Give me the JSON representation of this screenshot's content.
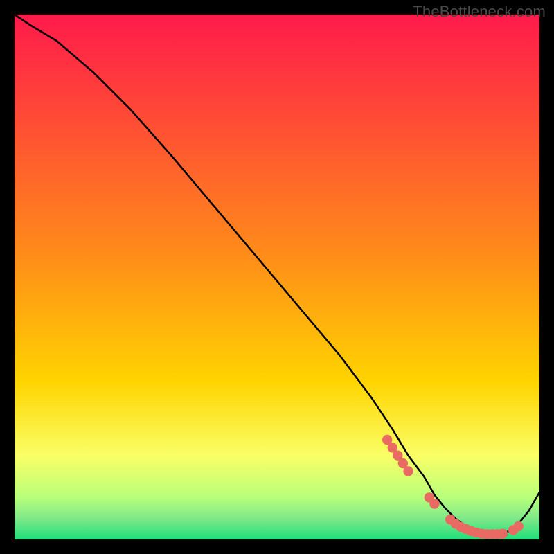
{
  "watermark": "TheBottleneck.com",
  "colors": {
    "curve": "#000000",
    "dots": "#e86a62",
    "bg_top": "#ff1a4b",
    "bg_mid": "#ffd400",
    "bg_low1": "#faff66",
    "bg_low2": "#b8ff7a",
    "bg_bottom": "#1fe07a",
    "frame": "#000000"
  },
  "chart_data": {
    "type": "line",
    "title": "",
    "xlabel": "",
    "ylabel": "",
    "xlim": [
      0,
      100
    ],
    "ylim": [
      0,
      100
    ],
    "x": [
      0,
      3,
      8,
      15,
      22,
      30,
      38,
      46,
      54,
      62,
      68,
      72,
      75,
      78,
      80,
      82,
      84,
      86,
      88,
      90,
      92,
      94,
      96,
      98,
      100
    ],
    "values": [
      100,
      98,
      95,
      89,
      82,
      73,
      63.5,
      54,
      44.5,
      35,
      27,
      21,
      16,
      12,
      8.5,
      6,
      4,
      2.5,
      1.5,
      1,
      1,
      1.5,
      3,
      5.5,
      9
    ],
    "dots": [
      {
        "x": 71,
        "y": 19.0
      },
      {
        "x": 72,
        "y": 17.5
      },
      {
        "x": 73,
        "y": 16.0
      },
      {
        "x": 74,
        "y": 14.5
      },
      {
        "x": 75,
        "y": 13.0
      },
      {
        "x": 79,
        "y": 8.0
      },
      {
        "x": 80,
        "y": 6.8
      },
      {
        "x": 83,
        "y": 3.8
      },
      {
        "x": 84,
        "y": 3.0
      },
      {
        "x": 85,
        "y": 2.4
      },
      {
        "x": 86,
        "y": 2.0
      },
      {
        "x": 87,
        "y": 1.6
      },
      {
        "x": 88,
        "y": 1.3
      },
      {
        "x": 89,
        "y": 1.1
      },
      {
        "x": 90,
        "y": 1.0
      },
      {
        "x": 91,
        "y": 1.0
      },
      {
        "x": 92,
        "y": 1.0
      },
      {
        "x": 93,
        "y": 1.1
      },
      {
        "x": 95,
        "y": 1.8
      },
      {
        "x": 96,
        "y": 2.5
      }
    ]
  }
}
